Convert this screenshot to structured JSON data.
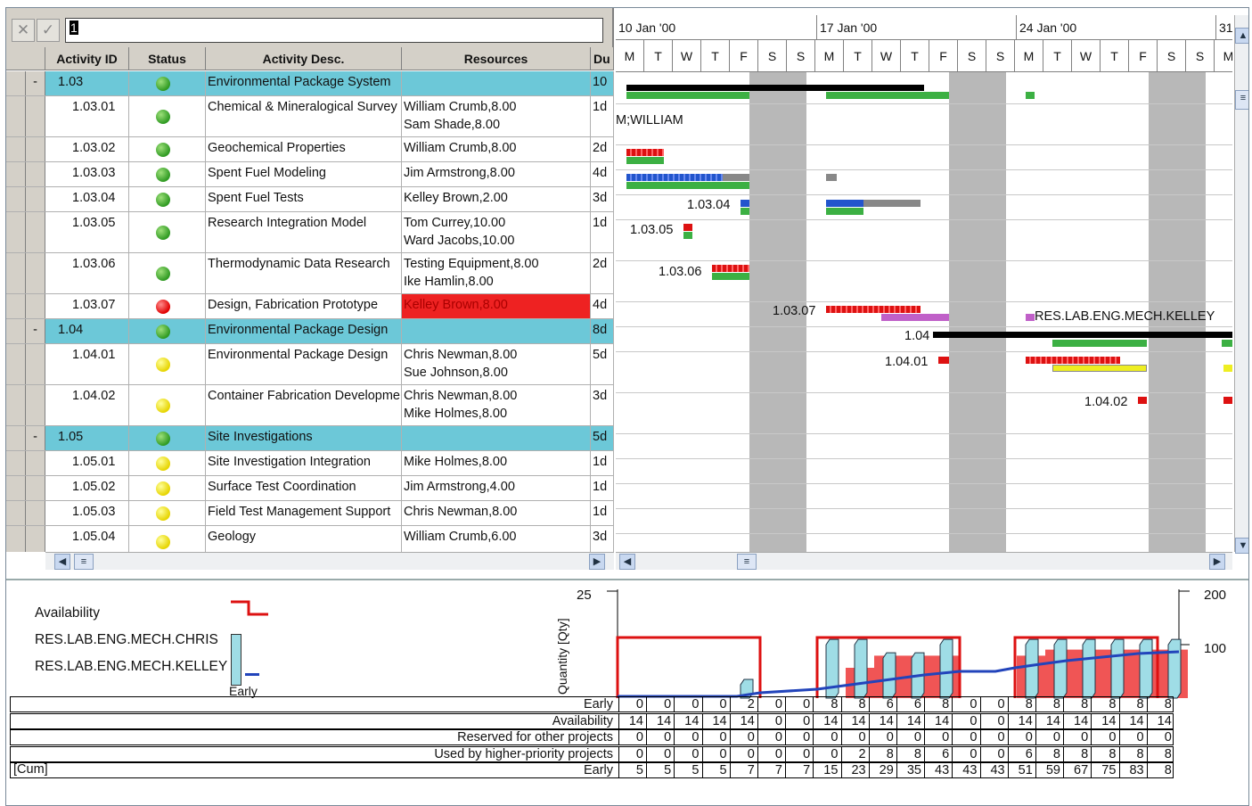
{
  "toolbar": {
    "cancel_icon": "✕",
    "accept_icon": "✓",
    "edit_value": "1"
  },
  "columns": {
    "activity_id": "Activity ID",
    "status": "Status",
    "activity_desc": "Activity Desc.",
    "resources": "Resources",
    "duration": "Du"
  },
  "rows": [
    {
      "id": "1.03",
      "status": "green",
      "desc": "Environmental Package System",
      "res1": "",
      "res2": "",
      "dur": "10",
      "summary": true
    },
    {
      "id": "1.03.01",
      "status": "green",
      "desc": "Chemical & Mineralogical Survey",
      "res1": "William Crumb,8.00",
      "res2": "Sam Shade,8.00",
      "dur": "1d"
    },
    {
      "id": "1.03.02",
      "status": "green",
      "desc": "Geochemical Properties",
      "res1": "William Crumb,8.00",
      "res2": "",
      "dur": "2d"
    },
    {
      "id": "1.03.03",
      "status": "green",
      "desc": "Spent Fuel Modeling",
      "res1": "Jim Armstrong,8.00",
      "res2": "",
      "dur": "4d"
    },
    {
      "id": "1.03.04",
      "status": "green",
      "desc": "Spent Fuel Tests",
      "res1": "Kelley Brown,2.00",
      "res2": "",
      "dur": "3d"
    },
    {
      "id": "1.03.05",
      "status": "green",
      "desc": "Research Integration Model",
      "res1": "Tom Currey,10.00",
      "res2": "Ward Jacobs,10.00",
      "dur": "1d"
    },
    {
      "id": "1.03.06",
      "status": "green",
      "desc": "Thermodynamic Data Research",
      "res1": "Testing Equipment,8.00",
      "res2": "Ike Hamlin,8.00",
      "dur": "2d"
    },
    {
      "id": "1.03.07",
      "status": "red",
      "desc": "Design, Fabrication Prototype",
      "res1": "Kelley Brown,8.00",
      "res2": "",
      "dur": "4d",
      "res_alert": true
    },
    {
      "id": "1.04",
      "status": "green",
      "desc": "Environmental Package Design",
      "res1": "",
      "res2": "",
      "dur": "8d",
      "summary": true
    },
    {
      "id": "1.04.01",
      "status": "yellow",
      "desc": "Environmental Package Design",
      "res1": "Chris Newman,8.00",
      "res2": "Sue Johnson,8.00",
      "dur": "5d"
    },
    {
      "id": "1.04.02",
      "status": "yellow",
      "desc": "Container Fabrication Development",
      "res1": "Chris Newman,8.00",
      "res2": "Mike Holmes,8.00",
      "dur": "3d"
    },
    {
      "id": "1.05",
      "status": "green",
      "desc": "Site Investigations",
      "res1": "",
      "res2": "",
      "dur": "5d",
      "summary": true
    },
    {
      "id": "1.05.01",
      "status": "yellow",
      "desc": "Site Investigation Integration",
      "res1": "Mike Holmes,8.00",
      "res2": "",
      "dur": "1d"
    },
    {
      "id": "1.05.02",
      "status": "yellow",
      "desc": "Surface Test Coordination",
      "res1": "Jim Armstrong,4.00",
      "res2": "",
      "dur": "1d"
    },
    {
      "id": "1.05.03",
      "status": "yellow",
      "desc": "Field Test Management Support",
      "res1": "Chris Newman,8.00",
      "res2": "",
      "dur": "1d"
    },
    {
      "id": "1.05.04",
      "status": "yellow",
      "desc": "Geology",
      "res1": "William Crumb,6.00",
      "res2": "",
      "dur": "3d"
    }
  ],
  "gantt": {
    "weeks": [
      "10 Jan '00",
      "17 Jan '00",
      "24 Jan '00",
      "31"
    ],
    "days": [
      "M",
      "T",
      "W",
      "T",
      "F",
      "S",
      "S",
      "M",
      "T",
      "W",
      "T",
      "F",
      "S",
      "S",
      "M",
      "T",
      "W",
      "T",
      "F",
      "S",
      "S",
      "M"
    ],
    "labels": {
      "william": "M;WILLIAM",
      "a10304": "1.03.04",
      "a10305": "1.03.05",
      "a10306": "1.03.06",
      "a10307": "1.03.07",
      "res_kelley": "RES.LAB.ENG.MECH.KELLEY",
      "a104": "1.04",
      "a10401": "1.04.01",
      "a10402": "1.04.02"
    }
  },
  "histogram": {
    "legend": {
      "availability": "Availability",
      "chris": "RES.LAB.ENG.MECH.CHRIS",
      "kelley": "RES.LAB.ENG.MECH.KELLEY",
      "early": "Early"
    },
    "y_axis_label": "Quantity [Qty]",
    "y_left_max": "25",
    "y_right_max": "200",
    "y_right_mid": "100",
    "cum_label": "[Cum]",
    "rows": [
      {
        "label": "Early",
        "values": [
          "0",
          "0",
          "0",
          "0",
          "2",
          "0",
          "0",
          "8",
          "8",
          "6",
          "6",
          "8",
          "0",
          "0",
          "8",
          "8",
          "8",
          "8",
          "8",
          "8"
        ]
      },
      {
        "label": "Availability",
        "values": [
          "14",
          "14",
          "14",
          "14",
          "14",
          "0",
          "0",
          "14",
          "14",
          "14",
          "14",
          "14",
          "0",
          "0",
          "14",
          "14",
          "14",
          "14",
          "14",
          "14"
        ]
      },
      {
        "label": "Reserved for other projects",
        "values": [
          "0",
          "0",
          "0",
          "0",
          "0",
          "0",
          "0",
          "0",
          "0",
          "0",
          "0",
          "0",
          "0",
          "0",
          "0",
          "0",
          "0",
          "0",
          "0",
          "0"
        ]
      },
      {
        "label": "Used by higher-priority projects",
        "values": [
          "0",
          "0",
          "0",
          "0",
          "0",
          "0",
          "0",
          "0",
          "2",
          "8",
          "8",
          "6",
          "0",
          "0",
          "6",
          "8",
          "8",
          "8",
          "8",
          "8"
        ]
      },
      {
        "label": "Early",
        "values": [
          "5",
          "5",
          "5",
          "5",
          "7",
          "7",
          "7",
          "15",
          "23",
          "29",
          "35",
          "43",
          "43",
          "43",
          "51",
          "59",
          "67",
          "75",
          "83",
          "8"
        ]
      }
    ]
  },
  "colors": {
    "summary": "#6cc8d8",
    "alert": "#ee2222",
    "weekend": "#b8b8b8",
    "green_bar": "#3cb043",
    "blue_bar": "#2255cc",
    "red_bar": "#dd1111",
    "purple_bar": "#c060c8",
    "yellow_bar": "#eeee22"
  }
}
